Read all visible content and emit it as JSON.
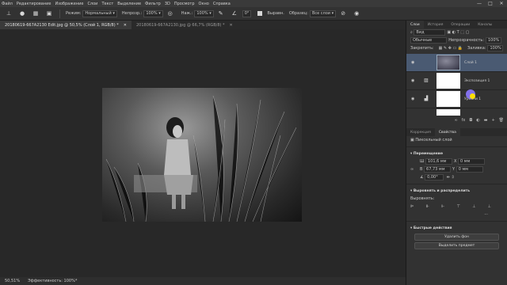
{
  "menubar": {
    "items": [
      "Файл",
      "Редактирование",
      "Изображение",
      "Слои",
      "Текст",
      "Выделение",
      "Фильтр",
      "3D",
      "Просмотр",
      "Окно",
      "Справка"
    ],
    "controls": [
      "—",
      "□",
      "✕"
    ]
  },
  "options": {
    "mode_label": "Режим:",
    "mode_value": "Нормальный",
    "opacity_label": "Непрозр.:",
    "opacity_value": "100%",
    "pressure_label": "Наж.:",
    "pressure_value": "100%",
    "angle_value": "0°",
    "sample_all_label": "Выравн.",
    "sample_label": "Образец:",
    "sample_value": "Все слои"
  },
  "doctabs": [
    {
      "title": "20180619-667A2130 Edit.jpg @ 50,5% (Слой 1, RGB/8) *",
      "active": true
    },
    {
      "title": "20180619-667A2130.jpg @ 66,7% (RGB/8) *",
      "active": false
    }
  ],
  "status": {
    "zoom": "50,51%",
    "efficiency": "Эффективность: 100%*"
  },
  "panel": {
    "tabs": [
      "Слои",
      "История",
      "Операции",
      "Каналы"
    ],
    "kind_value": "Вид",
    "blend_value": "Обычные",
    "opacity_label": "Непрозрачность:",
    "opacity_value": "100%",
    "lock_label": "Закрепить:",
    "fill_label": "Заливка:",
    "fill_value": "100%"
  },
  "layers": [
    {
      "name": "Слой 1",
      "selected": true,
      "kind": "pixel"
    },
    {
      "name": "Экспозиция 1",
      "selected": false,
      "kind": "adjustment"
    },
    {
      "name": "Уровни 1",
      "selected": false,
      "kind": "adjustment"
    },
    {
      "name": "",
      "selected": false,
      "kind": "partial"
    }
  ],
  "props": {
    "tabs": [
      "Коррекция",
      "Свойства"
    ],
    "kind_label": "Пиксельный слой",
    "transform_header": "Перемещение",
    "w_label": "Ш",
    "w_value": "101,6 мм",
    "x_label": "X",
    "x_value": "0 мм",
    "h_label": "В",
    "h_value": "67,73 мм",
    "y_label": "Y",
    "y_value": "0 мм",
    "angle_value": "0,00°",
    "align_header": "Выровнять и распределить",
    "align_label": "Выровнять:",
    "quick_header": "Быстрые действия",
    "btn_remove_bg": "Удалить фон",
    "btn_select_subject": "Выделить предмет"
  },
  "colors": {
    "selected_layer": "#4a5a72",
    "accent_cursor": "#8c78ff"
  }
}
